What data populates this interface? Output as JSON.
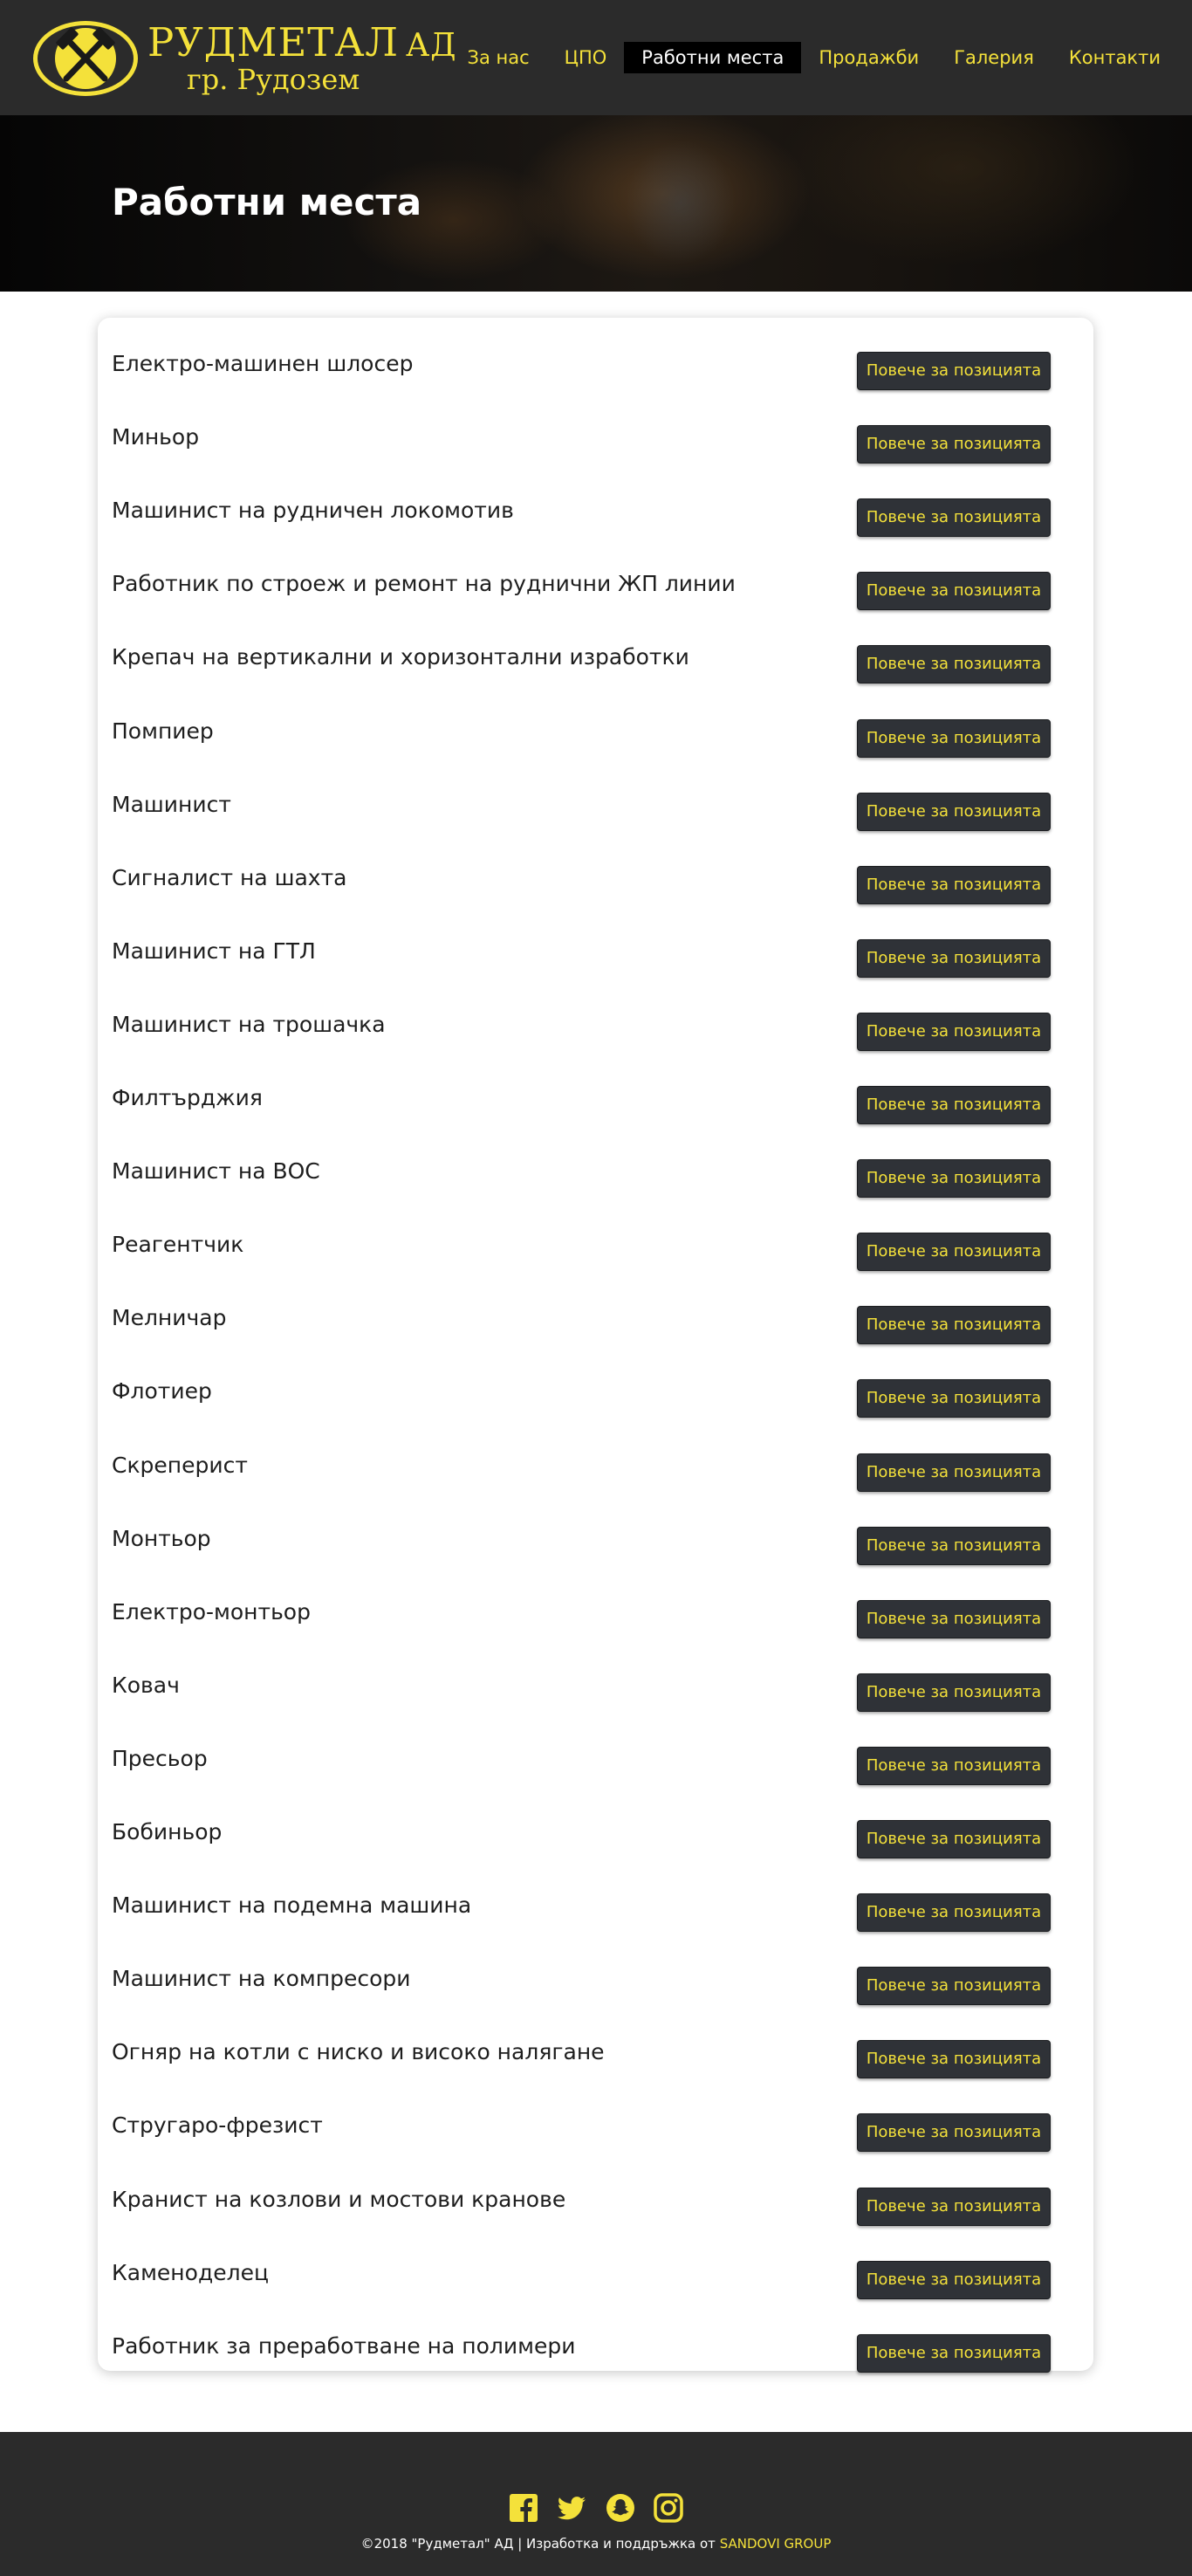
{
  "header": {
    "logo": {
      "title": "РУДМЕТАЛ",
      "suffix": "АД",
      "subtitle": "гр. Рудозем",
      "icon": "crossed-hammers-icon"
    },
    "nav": [
      {
        "label": "За нас"
      },
      {
        "label": "ЦПО"
      },
      {
        "label": "Работни места",
        "active": true
      },
      {
        "label": "Продажби"
      },
      {
        "label": "Галерия"
      },
      {
        "label": "Контакти"
      }
    ]
  },
  "hero": {
    "title": "Работни места"
  },
  "jobs": {
    "button_label": "Повече за позицията",
    "items": [
      "Електро-машинен шлосер",
      "Миньор",
      "Машинист на рудничен локомотив",
      "Работник по строеж и ремонт на руднични ЖП линии",
      "Крепач на вертикални и хоризонтални изработки",
      "Помпиер",
      "Машинист",
      "Сигналист на шахта",
      "Машинист на ГТЛ",
      "Машинист на трошачка",
      "Филтърджия",
      "Машинист на ВОС",
      "Реагентчик",
      "Мелничар",
      "Флотиер",
      "Скреперист",
      "Монтьор",
      "Електро-монтьор",
      "Ковач",
      "Пресьор",
      "Бобиньор",
      "Машинист на подемна машина",
      "Машинист на компресори",
      "Огняр на котли с ниско и високо налягане",
      "Стругаро-фрезист",
      "Кранист на козлови и мостови кранове",
      "Каменоделец",
      "Работник за преработване на полимери"
    ]
  },
  "footer": {
    "social": [
      "facebook-icon",
      "twitter-icon",
      "snapchat-icon",
      "instagram-icon"
    ],
    "copyright": "©2018 \"Рудметал\" АД | Изработка и поддръжка от ",
    "brand": "SANDOVI GROUP"
  },
  "colors": {
    "accent": "#f4e13a",
    "header_bg": "#2b2b2b",
    "button_bg": "#2f3237"
  }
}
